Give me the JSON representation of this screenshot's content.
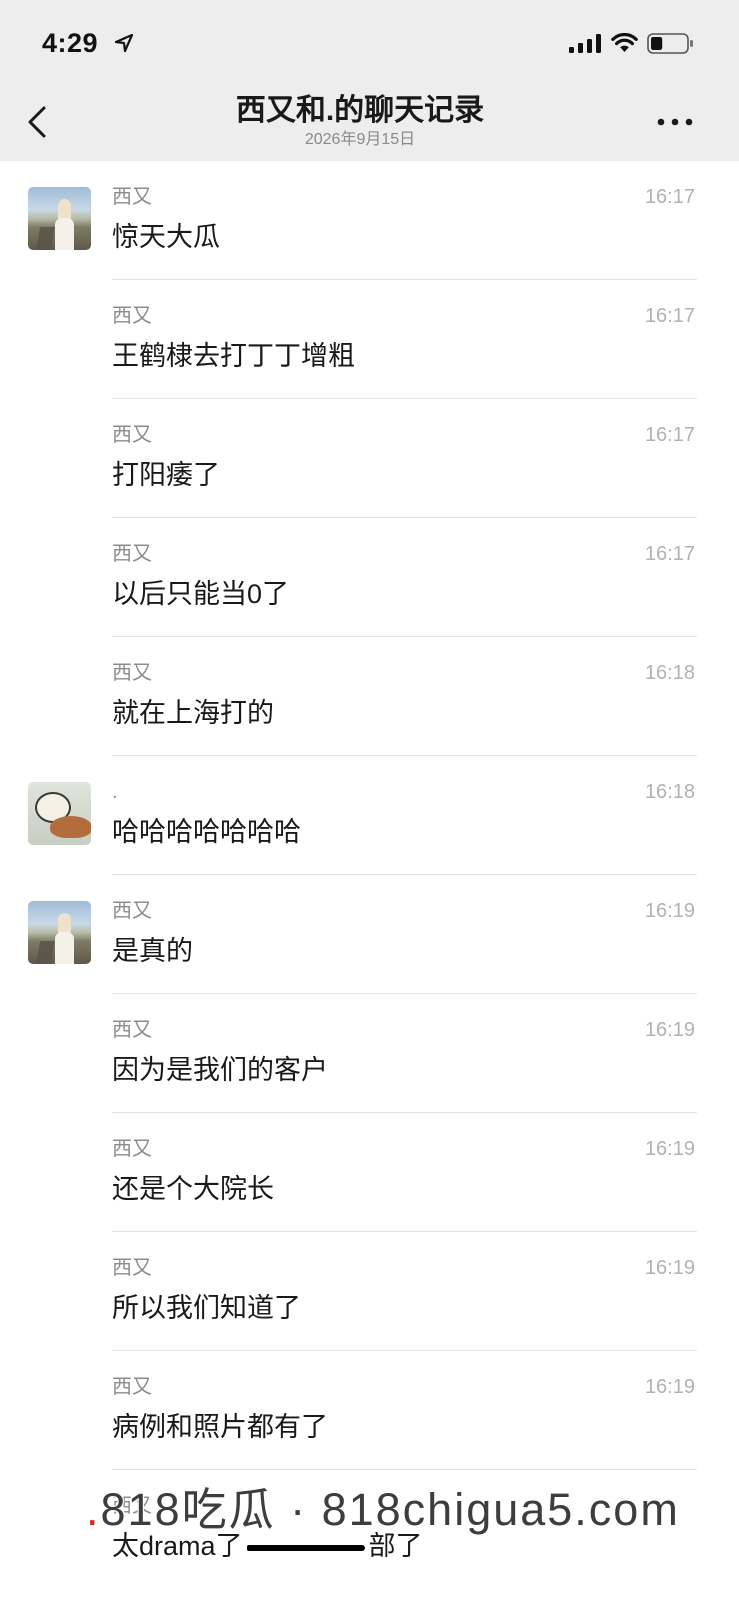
{
  "status_bar": {
    "time": "4:29",
    "signal_bars": 4,
    "battery_level": 0.33
  },
  "header": {
    "title": "西又和.的聊天记录",
    "subtitle": "2026年9月15日"
  },
  "messages": [
    {
      "sender": "西又",
      "time": "16:17",
      "text": "惊天大瓜"
    },
    {
      "sender": "西又",
      "time": "16:17",
      "text": "王鹤棣去打丁丁增粗"
    },
    {
      "sender": "西又",
      "time": "16:17",
      "text": "打阳痿了"
    },
    {
      "sender": "西又",
      "time": "16:17",
      "text": "以后只能当0了"
    },
    {
      "sender": "西又",
      "time": "16:18",
      "text": "就在上海打的"
    },
    {
      "sender": ".",
      "time": "16:18",
      "text": "哈哈哈哈哈哈哈"
    },
    {
      "sender": "西又",
      "time": "16:19",
      "text": "是真的"
    },
    {
      "sender": "西又",
      "time": "16:19",
      "text": "因为是我们的客户"
    },
    {
      "sender": "西又",
      "time": "16:19",
      "text": "还是个大院长"
    },
    {
      "sender": "西又",
      "time": "16:19",
      "text": "所以我们知道了"
    },
    {
      "sender": "西又",
      "time": "16:19",
      "text": "病例和照片都有了"
    },
    {
      "sender": "西又",
      "text": "太drama了",
      "text_after_redaction": "部了"
    }
  ],
  "watermark": {
    "dot": ".",
    "text": "818吃瓜 · 818chigua5.com"
  },
  "colors": {
    "header_bg": "#ededed",
    "list_bg": "#ffffff",
    "text": "#191919",
    "sender": "#8c8c8c",
    "time": "#b2b2b2",
    "separator": "#e5e5e5",
    "watermark_dot": "#d42a2a"
  }
}
